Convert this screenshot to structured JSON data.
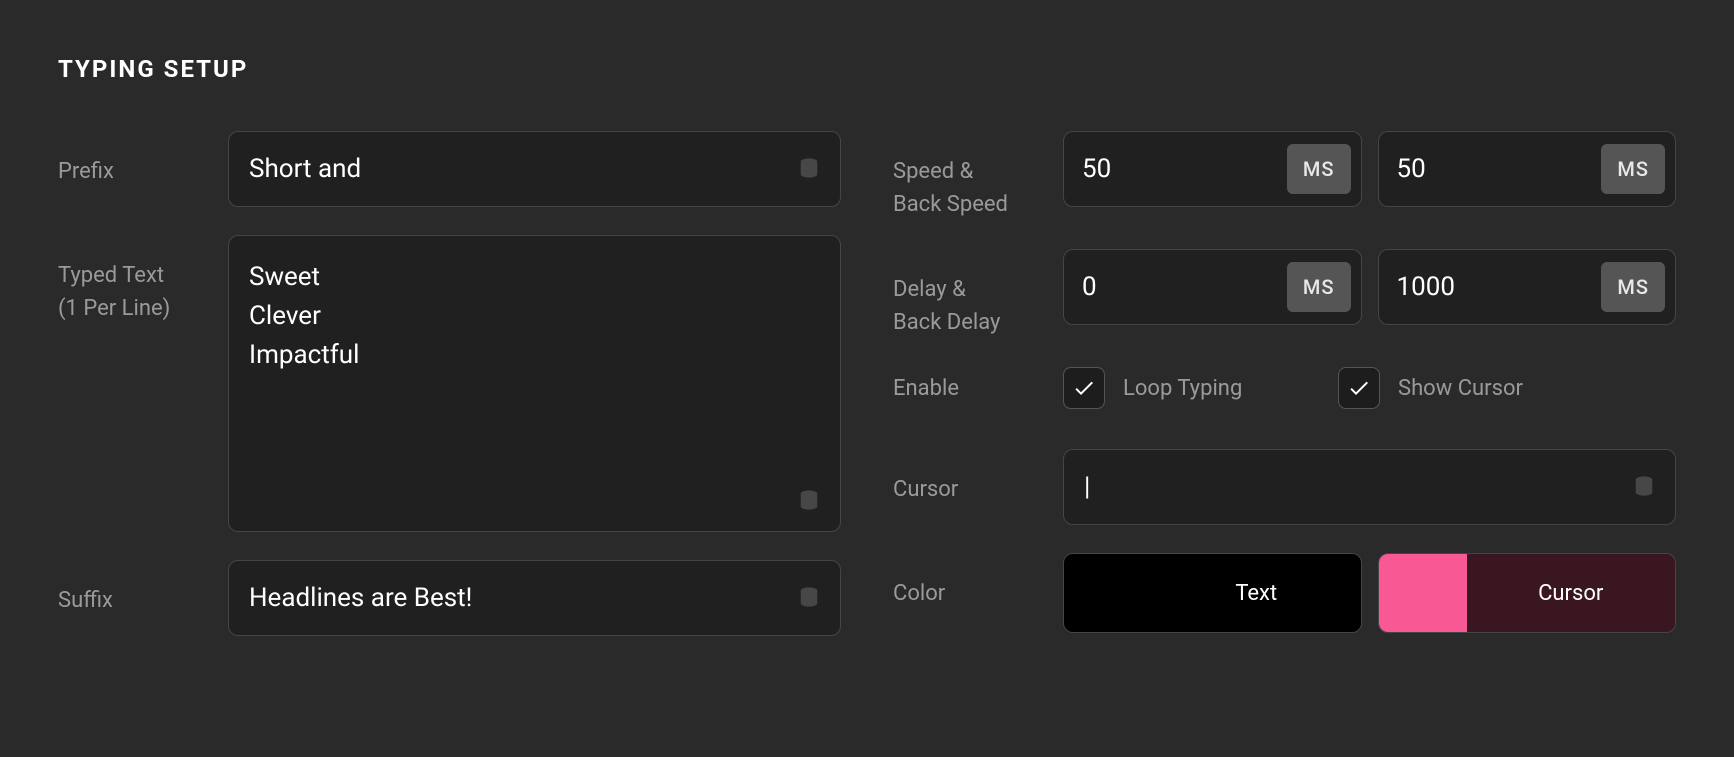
{
  "section_title": "TYPING SETUP",
  "labels": {
    "prefix": "Prefix",
    "typed_text_l1": "Typed Text",
    "typed_text_l2": "(1 Per Line)",
    "suffix": "Suffix",
    "speed_l1": "Speed &",
    "speed_l2": "Back Speed",
    "delay_l1": "Delay &",
    "delay_l2": "Back Delay",
    "enable": "Enable",
    "cursor": "Cursor",
    "color": "Color"
  },
  "prefix_value": "Short and",
  "typed_text_value": "Sweet\nClever\nImpactful",
  "suffix_value": "Headlines are Best!",
  "speed": {
    "value": "50",
    "unit": "MS"
  },
  "back_speed": {
    "value": "50",
    "unit": "MS"
  },
  "delay": {
    "value": "0",
    "unit": "MS"
  },
  "back_delay": {
    "value": "1000",
    "unit": "MS"
  },
  "enable": {
    "loop_typing_label": "Loop Typing",
    "loop_typing_checked": true,
    "show_cursor_label": "Show Cursor",
    "show_cursor_checked": true
  },
  "cursor_value": "|",
  "color": {
    "text_label": "Text",
    "text_swatch": "#000000",
    "text_bg": "#000000",
    "cursor_label": "Cursor",
    "cursor_swatch": "#f85994",
    "cursor_bg": "#3a1720"
  }
}
